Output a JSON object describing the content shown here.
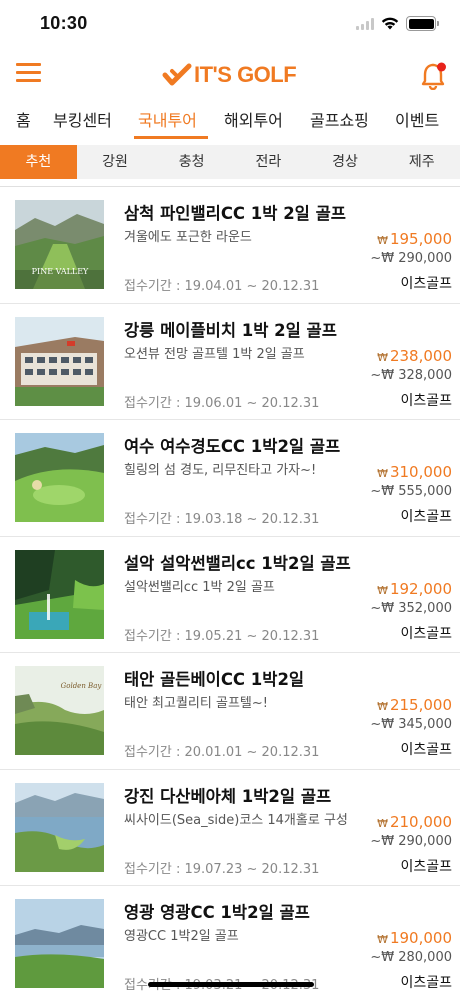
{
  "status_bar": {
    "time": "10:30"
  },
  "header": {
    "logo_text": "IT'S GOLF",
    "accent": "#f07a22",
    "icons": [
      "menu-icon",
      "bell-icon"
    ]
  },
  "main_tabs": [
    {
      "label": "홈"
    },
    {
      "label": "부킹센터"
    },
    {
      "label": "국내투어"
    },
    {
      "label": "해외투어"
    },
    {
      "label": "골프쇼핑"
    },
    {
      "label": "이벤트"
    }
  ],
  "main_tab_active": "국내투어",
  "region_tabs": [
    {
      "label": "추천"
    },
    {
      "label": "강원"
    },
    {
      "label": "충청"
    },
    {
      "label": "전라"
    },
    {
      "label": "경상"
    },
    {
      "label": "제주"
    }
  ],
  "region_tab_active": "추천",
  "products": [
    {
      "title": "삼척 파인밸리CC 1박 2일 골프",
      "subtitle": "겨울에도 포근한 라운드",
      "period": "접수기간 : 19.04.01 ~ 20.12.31",
      "price": "195,000",
      "original": "~₩ 290,000",
      "vendor": "이츠골프",
      "thumb_caption": "PINE VALLEY"
    },
    {
      "title": "강릉 메이플비치 1박 2일 골프",
      "subtitle": "오션뷰 전망 골프텔 1박 2일 골프",
      "period": "접수기간 : 19.06.01 ~ 20.12.31",
      "price": "238,000",
      "original": "~₩ 328,000",
      "vendor": "이츠골프"
    },
    {
      "title": "여수 여수경도CC 1박2일 골프",
      "subtitle": "힐링의 섬 경도, 리무진타고 가자~!",
      "period": "접수기간 : 19.03.18 ~ 20.12.31",
      "price": "310,000",
      "original": "~₩ 555,000",
      "vendor": "이츠골프"
    },
    {
      "title": "설악 설악썬밸리cc 1박2일 골프",
      "subtitle": "설악썬밸리cc 1박 2일 골프",
      "period": "접수기간 : 19.05.21 ~ 20.12.31",
      "price": "192,000",
      "original": "~₩ 352,000",
      "vendor": "이츠골프"
    },
    {
      "title": "태안 골든베이CC 1박2일",
      "subtitle": "태안 최고퀄리티 골프텔~!",
      "period": "접수기간 : 20.01.01 ~ 20.12.31",
      "price": "215,000",
      "original": "~₩ 345,000",
      "vendor": "이츠골프",
      "thumb_caption": "Golden Bay"
    },
    {
      "title": "강진 다산베아체 1박2일 골프",
      "subtitle": "씨사이드(Sea_side)코스 14개홀로 구성",
      "period": "접수기간 : 19.07.23 ~ 20.12.31",
      "price": "210,000",
      "original": "~₩ 290,000",
      "vendor": "이츠골프"
    },
    {
      "title": "영광 영광CC 1박2일 골프",
      "subtitle": "영광CC 1박2일 골프",
      "period": "접수기간 : 19.03.21 ~ 20.12.31",
      "price": "190,000",
      "original": "~₩ 280,000",
      "vendor": "이츠골프"
    }
  ],
  "currency_symbol": "₩"
}
